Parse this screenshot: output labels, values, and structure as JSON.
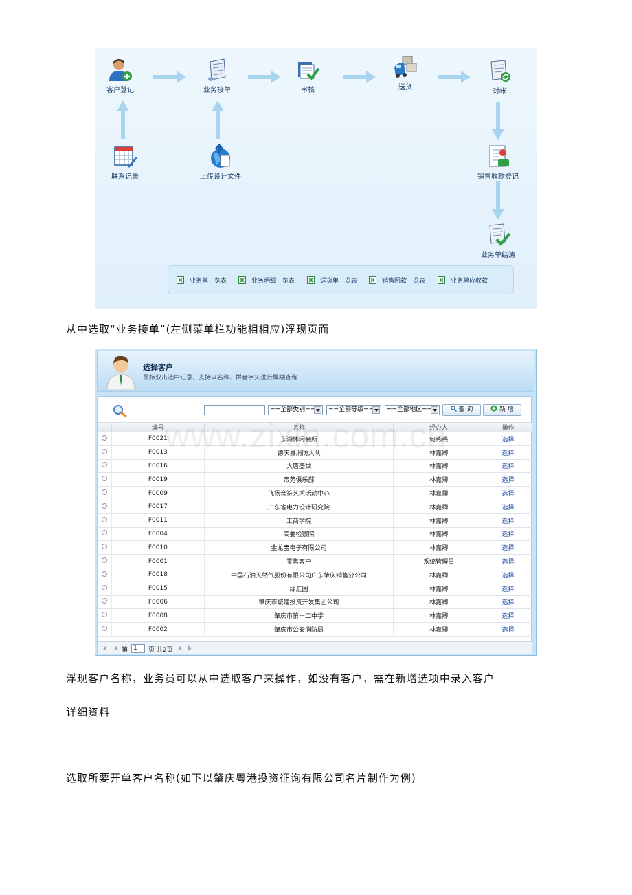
{
  "workflow": {
    "steps": [
      {
        "label": "客户登记",
        "icon": "user-add-icon"
      },
      {
        "label": "业务接单",
        "icon": "scroll-icon"
      },
      {
        "label": "审核",
        "icon": "audit-icon"
      },
      {
        "label": "送货",
        "icon": "delivery-truck-icon"
      },
      {
        "label": "对帐",
        "icon": "reconcile-icon"
      }
    ],
    "sub_steps": [
      {
        "label": "联系记录",
        "icon": "calendar-icon"
      },
      {
        "label": "上传设计文件",
        "icon": "upload-globe-icon"
      },
      {
        "label": "销售收款登记",
        "icon": "payment-document-icon"
      },
      {
        "label": "业务单结清",
        "icon": "settled-scroll-icon"
      }
    ],
    "reports": [
      "业务单一览表",
      "业务明细一览表",
      "送货单一览表",
      "销售回款一览表",
      "业务单应收款"
    ]
  },
  "text": {
    "p1": "从中选取“业务接单”(左侧菜单栏功能相相应)浮现页面",
    "p2_line1": "浮现客户名称，业务员可以从中选取客户来操作，如没有客户，需在新增选项中录入客户",
    "p2_line2": "详细资料",
    "p3": "选取所要开单客户名称(如下以肇庆粤港投资征询有限公司名片制作为例)"
  },
  "dialog": {
    "title": "选择客户",
    "subtitle": "鼠标双击选中记录，支持以名称、拼音字头进行模糊查询",
    "search_value": "",
    "filters": [
      "==全部类别==",
      "==全部等级==",
      "==全部地区=="
    ],
    "query_button": "查 询",
    "add_button": "新 增",
    "columns": [
      "编号",
      "名称",
      "经办人",
      "操作"
    ],
    "rows": [
      [
        "F0021",
        "东湖休闲会所",
        "何燕燕",
        "选择"
      ],
      [
        "F0013",
        "德庆县消防大队",
        "林嘉卿",
        "选择"
      ],
      [
        "F0016",
        "大唐盛世",
        "林嘉卿",
        "选择"
      ],
      [
        "F0019",
        "帝苑俱乐部",
        "林嘉卿",
        "选择"
      ],
      [
        "F0009",
        "飞扬音符艺术活动中心",
        "林嘉卿",
        "选择"
      ],
      [
        "F0017",
        "广东省电力设计研究院",
        "林嘉卿",
        "选择"
      ],
      [
        "F0011",
        "工商学院",
        "林嘉卿",
        "选择"
      ],
      [
        "F0004",
        "高要检察院",
        "林嘉卿",
        "选择"
      ],
      [
        "F0010",
        "金龙宝电子有限公司",
        "林嘉卿",
        "选择"
      ],
      [
        "F0001",
        "零售客户",
        "系统管理员",
        "选择"
      ],
      [
        "F0018",
        "中国石油天然气股份有限公司广东肇庆销售分公司",
        "林嘉卿",
        "选择"
      ],
      [
        "F0015",
        "绿汇园",
        "林嘉卿",
        "选择"
      ],
      [
        "F0006",
        "肇庆市城建投资开发集团公司",
        "林嘉卿",
        "选择"
      ],
      [
        "F0008",
        "肇庆市第十二中学",
        "林嘉卿",
        "选择"
      ],
      [
        "F0002",
        "肇庆市公安消防局",
        "林嘉卿",
        "选择"
      ]
    ],
    "pager": {
      "prefix": "第",
      "page": "1",
      "suffix": "页 共2页"
    }
  },
  "watermark": "www.zixin.com.cn"
}
